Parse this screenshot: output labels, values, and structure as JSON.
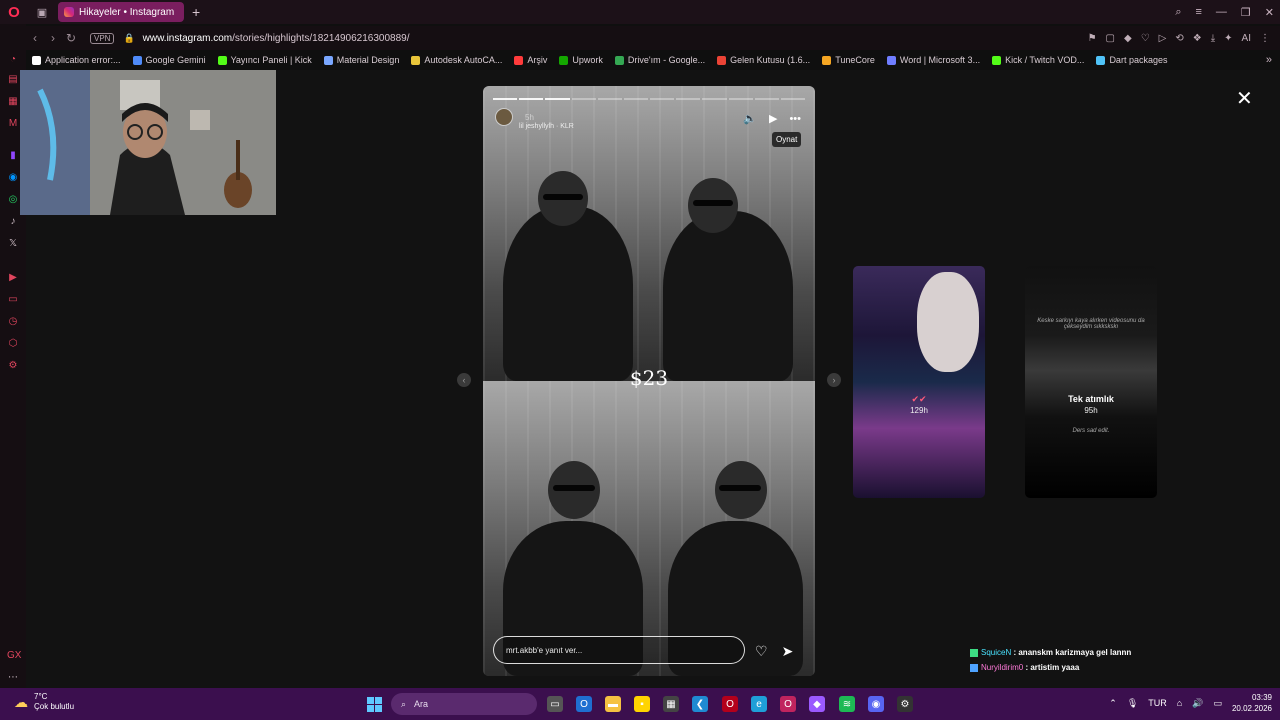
{
  "browser": {
    "tab_title": "Hikayeler • Instagram",
    "vpn_label": "VPN",
    "url_host": "www.instagram.com",
    "url_path": "/stories/highlights/18214906216300889/",
    "ai_label": "AI"
  },
  "bookmarks": [
    {
      "label": "Application error:...",
      "color": "#ffffff"
    },
    {
      "label": "Google Gemini",
      "color": "#4f8bf9"
    },
    {
      "label": "Yayıncı Paneli | Kick",
      "color": "#53fc18"
    },
    {
      "label": "Material Design",
      "color": "#7aa7ff"
    },
    {
      "label": "Autodesk AutoCA...",
      "color": "#e8c53a"
    },
    {
      "label": "Arşiv",
      "color": "#ff3b3b"
    },
    {
      "label": "Upwork",
      "color": "#14a800"
    },
    {
      "label": "Drive'ım - Google...",
      "color": "#34a853"
    },
    {
      "label": "Gelen Kutusu (1.6...",
      "color": "#ea4335"
    },
    {
      "label": "TuneCore",
      "color": "#f5a623"
    },
    {
      "label": "Word | Microsoft 3...",
      "color": "#6f7dff"
    },
    {
      "label": "Kick / Twitch VOD...",
      "color": "#53fc18"
    },
    {
      "label": "Dart packages",
      "color": "#4fc3f7"
    }
  ],
  "story": {
    "username": "",
    "time": "5h",
    "subtitle": "lil jeshyllylh · KLR",
    "tooltip": "Oynat",
    "caption": "$23",
    "reply_placeholder": "mrt.akbb'e yanıt ver..."
  },
  "previews": [
    {
      "title": "✔✔",
      "time": "129h"
    },
    {
      "title": "Tek atımlık",
      "time": "95h",
      "top_text": "Keske sarkıyı kaya alırken videosunu da çekseydim sıkkskskı",
      "bottom_text": "Ders sad edit."
    }
  ],
  "chat": [
    {
      "user": "SquiceN",
      "message": "ananskm karizmaya gel lannn"
    },
    {
      "user": "Nuryildirim0",
      "message": "artistim yaaa"
    }
  ],
  "taskbar": {
    "temperature": "7°C",
    "weather": "Çok bulutlu",
    "search_label": "Ara",
    "language": "TUR",
    "time": "03:39",
    "date": "20.02.2026"
  }
}
